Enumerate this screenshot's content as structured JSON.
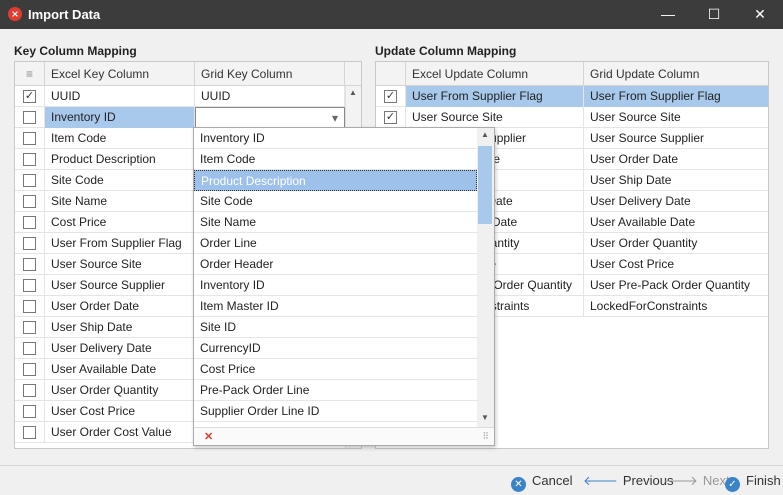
{
  "window": {
    "title": "Import Data",
    "minimize_glyph": "—",
    "maximize_glyph": "☐",
    "close_glyph": "✕"
  },
  "left": {
    "title": "Key Column Mapping",
    "headers": {
      "excel": "Excel Key Column",
      "grid": "Grid Key Column"
    },
    "rows": [
      {
        "checked": true,
        "excel": "UUID",
        "grid": "UUID"
      },
      {
        "checked": false,
        "excel": "Inventory ID",
        "grid": ""
      },
      {
        "checked": false,
        "excel": "Item Code",
        "grid": ""
      },
      {
        "checked": false,
        "excel": "Product Description",
        "grid": ""
      },
      {
        "checked": false,
        "excel": "Site Code",
        "grid": ""
      },
      {
        "checked": false,
        "excel": "Site Name",
        "grid": ""
      },
      {
        "checked": false,
        "excel": "Cost Price",
        "grid": ""
      },
      {
        "checked": false,
        "excel": "User From Supplier Flag",
        "grid": ""
      },
      {
        "checked": false,
        "excel": "User Source Site",
        "grid": ""
      },
      {
        "checked": false,
        "excel": "User Source Supplier",
        "grid": ""
      },
      {
        "checked": false,
        "excel": "User Order Date",
        "grid": ""
      },
      {
        "checked": false,
        "excel": "User Ship Date",
        "grid": ""
      },
      {
        "checked": false,
        "excel": "User Delivery Date",
        "grid": ""
      },
      {
        "checked": false,
        "excel": "User Available Date",
        "grid": ""
      },
      {
        "checked": false,
        "excel": "User Order Quantity",
        "grid": ""
      },
      {
        "checked": false,
        "excel": "User Cost Price",
        "grid": ""
      },
      {
        "checked": false,
        "excel": "User Order Cost Value",
        "grid": ""
      }
    ]
  },
  "right": {
    "title": "Update Column Mapping",
    "headers": {
      "excel": "Excel Update Column",
      "grid": "Grid Update Column"
    },
    "rows": [
      {
        "checked": true,
        "excel": "User From Supplier Flag",
        "grid": "User From Supplier Flag"
      },
      {
        "checked": true,
        "excel": "User Source Site",
        "grid": "User Source Site"
      },
      {
        "checked": false,
        "excel": "User Source Supplier",
        "grid": "User Source Supplier"
      },
      {
        "checked": false,
        "excel": "User Order Date",
        "grid": "User Order Date"
      },
      {
        "checked": false,
        "excel": "User Ship Date",
        "grid": "User Ship Date"
      },
      {
        "checked": false,
        "excel": "User Delivery Date",
        "grid": "User Delivery Date"
      },
      {
        "checked": false,
        "excel": "User Available Date",
        "grid": "User Available Date"
      },
      {
        "checked": false,
        "excel": "User Order Quantity",
        "grid": "User Order Quantity"
      },
      {
        "checked": false,
        "excel": "User Cost Price",
        "grid": "User Cost Price"
      },
      {
        "checked": false,
        "excel": "User Pre-Pack Order Quantity",
        "grid": "User Pre-Pack Order Quantity"
      },
      {
        "checked": false,
        "excel": "LockedForConstraints",
        "grid": "LockedForConstraints"
      }
    ]
  },
  "dropdown": {
    "items": [
      "Inventory ID",
      "Item Code",
      "Product Description",
      "Site Code",
      "Site Name",
      "Order Line",
      "Order Header",
      "Inventory ID",
      "Item Master ID",
      "Site ID",
      "CurrencyID",
      "Cost Price",
      "Pre-Pack Order Line",
      "Supplier Order Line ID"
    ],
    "highlighted_index": 2,
    "clear_glyph": "✕"
  },
  "footer": {
    "cancel": "Cancel",
    "previous": "Previous",
    "next": "Next",
    "finish": "Finish"
  },
  "colors": {
    "titlebar": "#3c3c3c",
    "selection": "#a8c8ec",
    "accent": "#3b83c9"
  }
}
